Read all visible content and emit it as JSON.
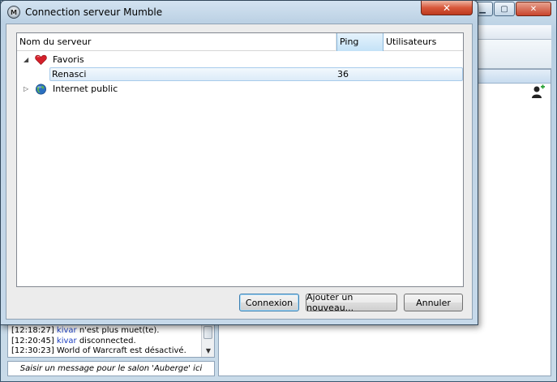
{
  "main_window": {
    "log_lines": [
      {
        "time": "[12:18:27]",
        "user": "kivar",
        "text": " n'est plus muet(te)."
      },
      {
        "time": "[12:20:45]",
        "user": "kivar",
        "text": " disconnected."
      },
      {
        "time": "[12:30:23]",
        "user": "",
        "text": " World of Warcraft est désactivé."
      }
    ],
    "chat_placeholder": "Saisir un message pour le salon 'Auberge' ici"
  },
  "dialog": {
    "title": "Connection serveur Mumble",
    "close_glyph": "✕",
    "app_icon_glyph": "M",
    "columns": {
      "server_name": "Nom du serveur",
      "ping": "Ping",
      "users": "Utilisateurs"
    },
    "sort_glyph": "^",
    "groups": [
      {
        "label": "Favoris",
        "expanded": true,
        "expander_glyph": "◢",
        "icon": "heart-icon",
        "servers": [
          {
            "name": "Renasci",
            "ping": "36",
            "users": ""
          }
        ]
      },
      {
        "label": "Internet public",
        "expanded": false,
        "expander_glyph": "▷",
        "icon": "globe-icon",
        "servers": []
      }
    ],
    "buttons": {
      "connect": "Connexion",
      "add_new": "Ajouter un nouveau...",
      "cancel": "Annuler"
    }
  },
  "colors": {
    "selection_bg": "#dcebf8",
    "heart": "#d4202a",
    "globe": "#2a6fc0",
    "log_user": "#1d3fbf"
  }
}
